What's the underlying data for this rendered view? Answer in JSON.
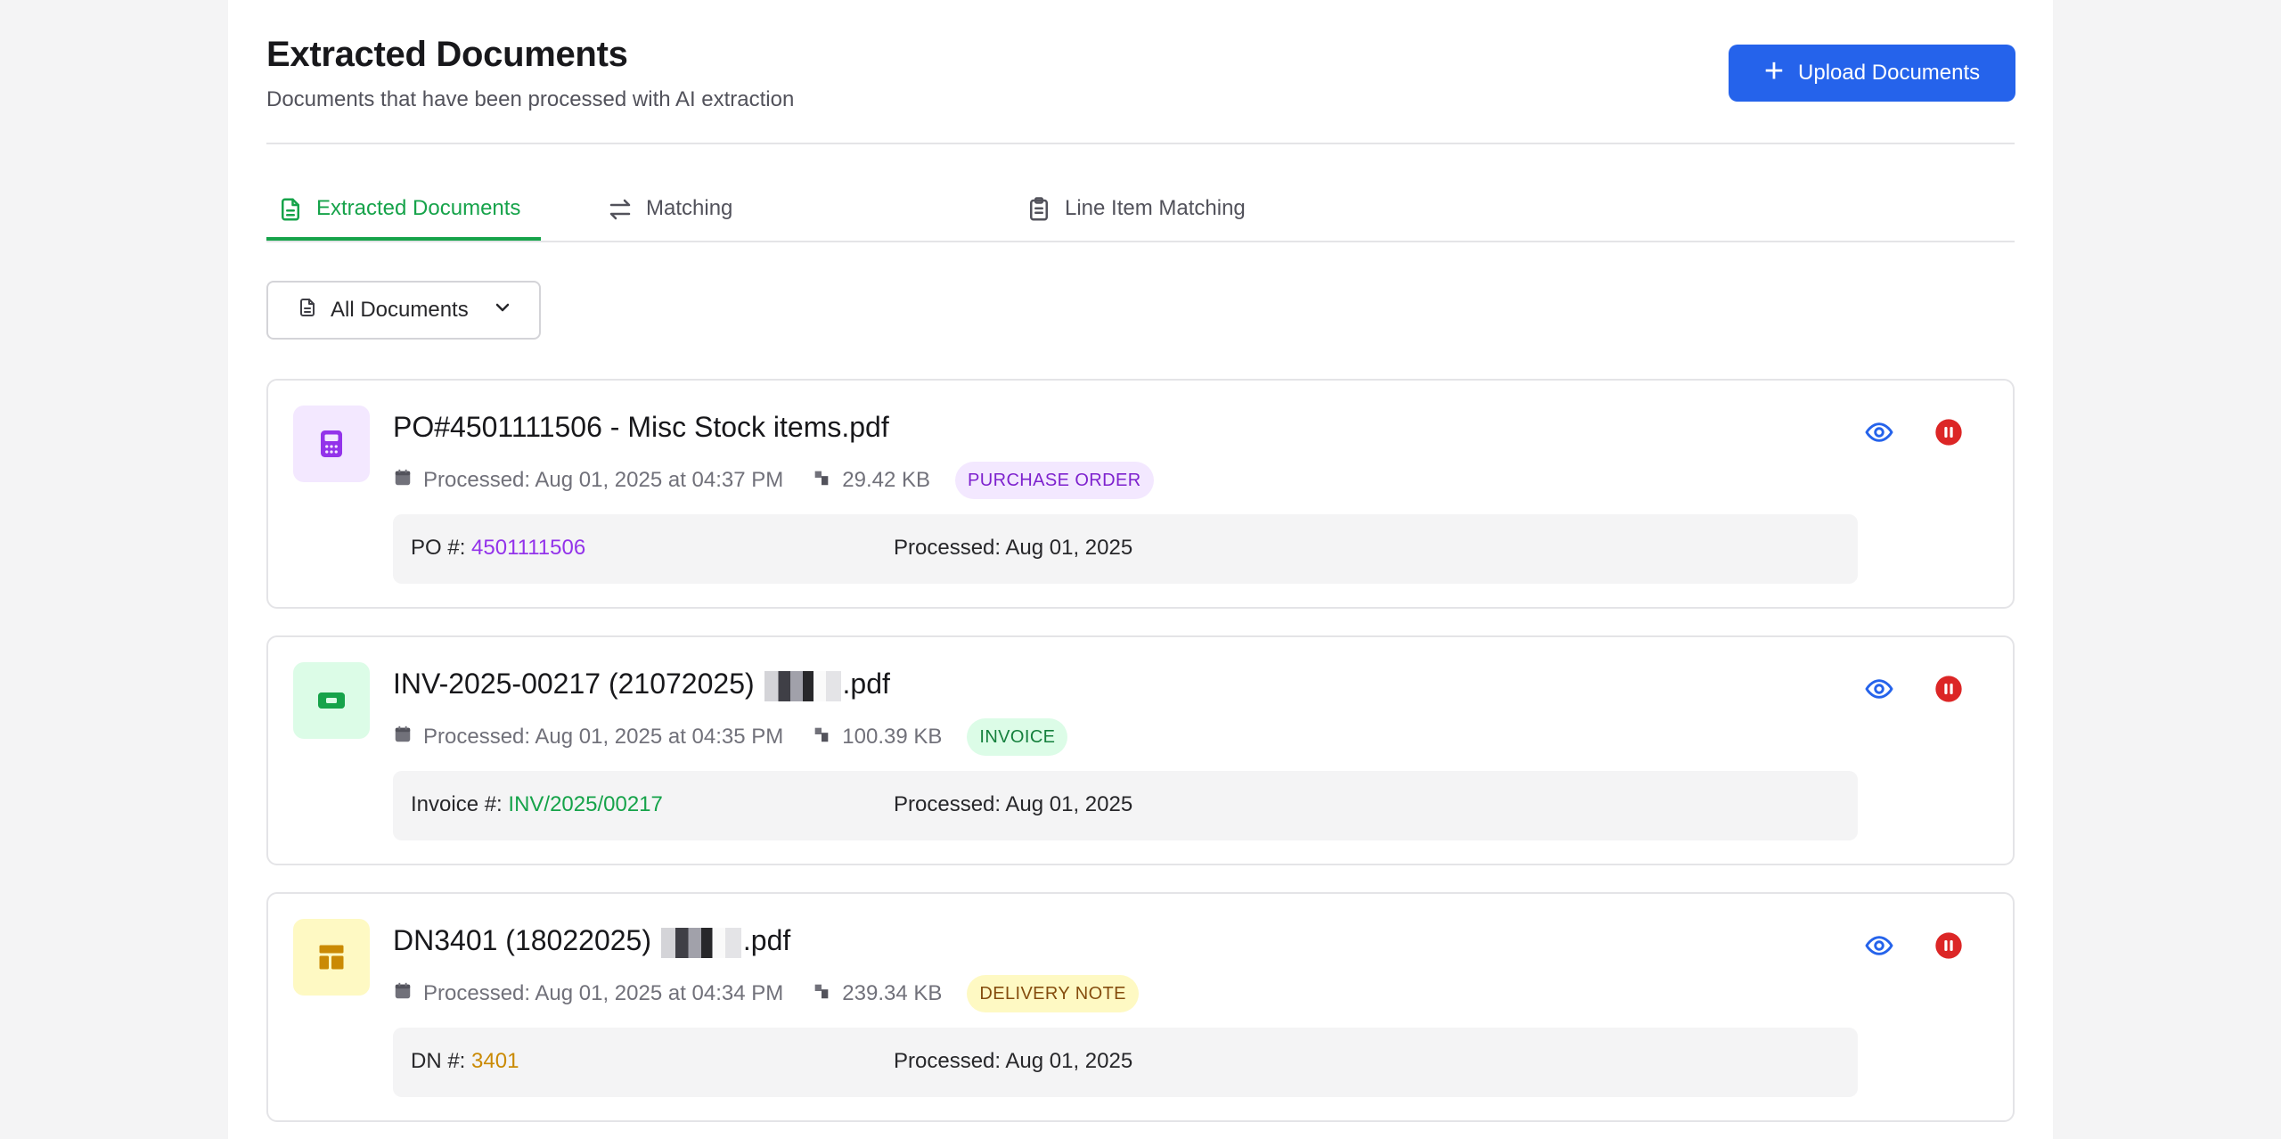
{
  "header": {
    "title": "Extracted Documents",
    "subtitle": "Documents that have been processed with AI extraction",
    "upload_label": "Upload Documents"
  },
  "tabs": [
    {
      "label": "Extracted Documents",
      "icon": "file-text-icon",
      "active": true
    },
    {
      "label": "Matching",
      "icon": "arrows-swap-icon",
      "active": false
    },
    {
      "label": "Line Item Matching",
      "icon": "clipboard-icon",
      "active": false
    }
  ],
  "filter": {
    "selected": "All Documents"
  },
  "documents": [
    {
      "title": "PO#4501111506 - Misc Stock items.pdf",
      "processed": "Processed: Aug 01, 2025 at 04:37 PM",
      "size": "29.42 KB",
      "badge": "PURCHASE ORDER",
      "ref_label": "PO #:",
      "ref_value": "4501111506",
      "processed_date": "Processed: Aug 01, 2025",
      "icon": "calculator-icon",
      "accent": "#9333ea",
      "badge_bg": "#f3e8ff",
      "icon_bg": "#f3e8ff"
    },
    {
      "title_prefix": "INV-2025-00217 (21072025)",
      "title_suffix": ".pdf",
      "processed": "Processed: Aug 01, 2025 at 04:35 PM",
      "size": "100.39 KB",
      "badge": "INVOICE",
      "ref_label": "Invoice #:",
      "ref_value": "INV/2025/00217",
      "processed_date": "Processed: Aug 01, 2025",
      "icon": "banknote-icon",
      "accent": "#16a34a",
      "badge_bg": "#dcfce7",
      "icon_bg": "#dcfce7"
    },
    {
      "title_prefix": "DN3401 (18022025)",
      "title_suffix": ".pdf",
      "processed": "Processed: Aug 01, 2025 at 04:34 PM",
      "size": "239.34 KB",
      "badge": "DELIVERY NOTE",
      "ref_label": "DN #:",
      "ref_value": "3401",
      "processed_date": "Processed: Aug 01, 2025",
      "icon": "layout-icon",
      "accent": "#ca8a04",
      "badge_bg": "#fef9c3",
      "icon_bg": "#fef9c3"
    }
  ],
  "colors": {
    "primary": "#2563eb",
    "active_tab": "#16a34a",
    "view_icon": "#2563eb",
    "pause_icon": "#dc2626"
  }
}
